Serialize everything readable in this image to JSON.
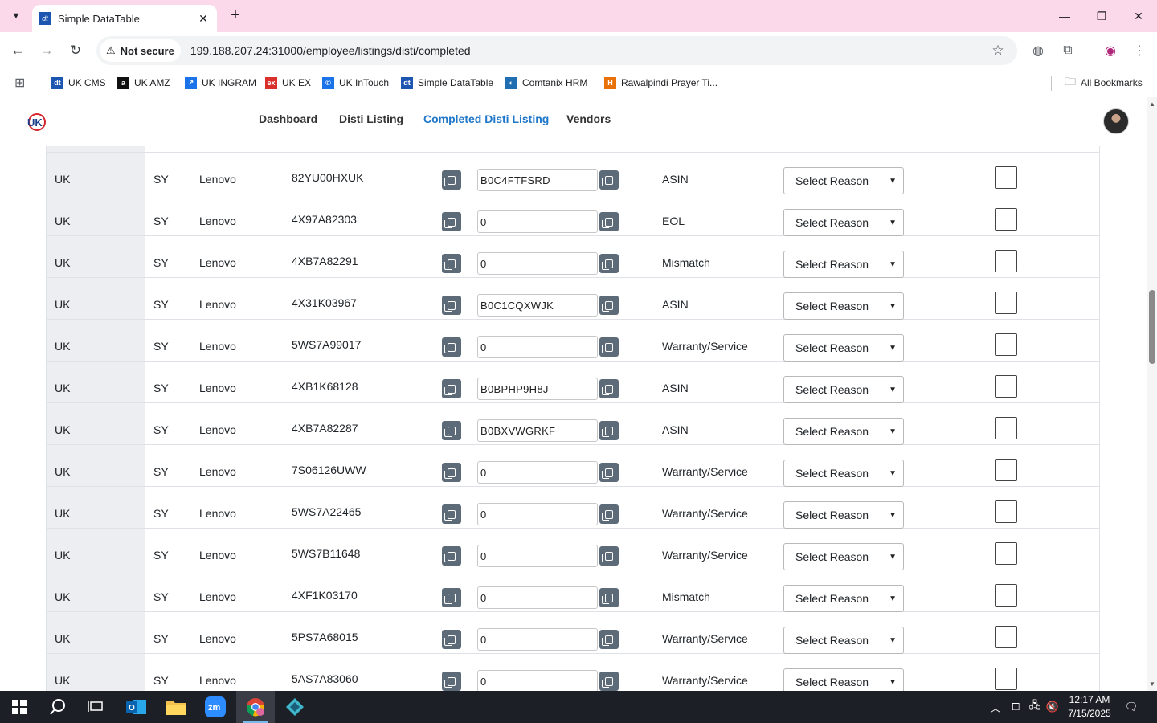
{
  "browser": {
    "tab_title": "Simple DataTable",
    "tab_favicon_text": "dt",
    "security_label": "Not secure",
    "url": "199.188.207.24:31000/employee/listings/disti/completed",
    "bookmarks": [
      {
        "label": "UK CMS",
        "icon": "cms-icon",
        "color": "#1d56b0",
        "glyph": "dt"
      },
      {
        "label": "UK AMZ",
        "icon": "amazon-icon",
        "color": "#111111",
        "glyph": "a"
      },
      {
        "label": "UK INGRAM",
        "icon": "ingram-icon",
        "color": "#1a73e8",
        "glyph": "↗"
      },
      {
        "label": "UK EX",
        "icon": "ex-icon",
        "color": "#d9302c",
        "glyph": "ex"
      },
      {
        "label": "UK InTouch",
        "icon": "intouch-icon",
        "color": "#1a73e8",
        "glyph": "©"
      },
      {
        "label": "Simple DataTable",
        "icon": "datatable-icon",
        "color": "#1d56b0",
        "glyph": "dt"
      },
      {
        "label": "Comtanix HRM",
        "icon": "hrm-icon",
        "color": "#1f6fb2",
        "glyph": "◐"
      },
      {
        "label": "Rawalpindi Prayer Ti...",
        "icon": "prayer-icon",
        "color": "#e8710a",
        "glyph": "H"
      }
    ],
    "all_bookmarks_label": "All Bookmarks"
  },
  "nav": {
    "links": [
      "Dashboard",
      "Disti Listing",
      "Completed Disti Listing",
      "Vendors"
    ],
    "active": "Completed Disti Listing"
  },
  "table": {
    "reason_placeholder": "Select Reason",
    "rows": [
      {
        "region": "UK",
        "sy": "SY",
        "brand": "Lenovo",
        "part": "82YU00HXUK",
        "asin": "B0C4FTFSRD",
        "status": "ASIN",
        "checked": false
      },
      {
        "region": "UK",
        "sy": "SY",
        "brand": "Lenovo",
        "part": "4X97A82303",
        "asin": "0",
        "status": "EOL",
        "checked": false
      },
      {
        "region": "UK",
        "sy": "SY",
        "brand": "Lenovo",
        "part": "4XB7A82291",
        "asin": "0",
        "status": "Mismatch",
        "checked": false
      },
      {
        "region": "UK",
        "sy": "SY",
        "brand": "Lenovo",
        "part": "4X31K03967",
        "asin": "B0C1CQXWJK",
        "status": "ASIN",
        "checked": false
      },
      {
        "region": "UK",
        "sy": "SY",
        "brand": "Lenovo",
        "part": "5WS7A99017",
        "asin": "0",
        "status": "Warranty/Service",
        "checked": false
      },
      {
        "region": "UK",
        "sy": "SY",
        "brand": "Lenovo",
        "part": "4XB1K68128",
        "asin": "B0BPHP9H8J",
        "status": "ASIN",
        "checked": false
      },
      {
        "region": "UK",
        "sy": "SY",
        "brand": "Lenovo",
        "part": "4XB7A82287",
        "asin": "B0BXVWGRKF",
        "status": "ASIN",
        "checked": false
      },
      {
        "region": "UK",
        "sy": "SY",
        "brand": "Lenovo",
        "part": "7S06126UWW",
        "asin": "0",
        "status": "Warranty/Service",
        "checked": false
      },
      {
        "region": "UK",
        "sy": "SY",
        "brand": "Lenovo",
        "part": "5WS7A22465",
        "asin": "0",
        "status": "Warranty/Service",
        "checked": false
      },
      {
        "region": "UK",
        "sy": "SY",
        "brand": "Lenovo",
        "part": "5WS7B11648",
        "asin": "0",
        "status": "Warranty/Service",
        "checked": false
      },
      {
        "region": "UK",
        "sy": "SY",
        "brand": "Lenovo",
        "part": "4XF1K03170",
        "asin": "0",
        "status": "Mismatch",
        "checked": false
      },
      {
        "region": "UK",
        "sy": "SY",
        "brand": "Lenovo",
        "part": "5PS7A68015",
        "asin": "0",
        "status": "Warranty/Service",
        "checked": false
      },
      {
        "region": "UK",
        "sy": "SY",
        "brand": "Lenovo",
        "part": "5AS7A83060",
        "asin": "0",
        "status": "Warranty/Service",
        "checked": false
      }
    ]
  },
  "taskbar": {
    "time": "12:17 AM",
    "date": "7/15/2025"
  }
}
